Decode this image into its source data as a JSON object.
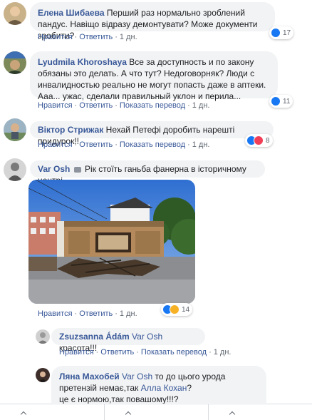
{
  "comments": [
    {
      "author": "Елена Шибаева",
      "text": "Перший раз нормально зроблений пандус. Навіщо відразу демонтувати? Може документи зробити?",
      "actions": {
        "like": "Нравится",
        "reply": "Ответить",
        "time": "1 дн."
      },
      "reactions": "17"
    },
    {
      "author": "Lyudmila Khoroshaya",
      "text": "Все за доступность и по закону обязаны это делать. А что тут? Недоговорняк? Люди с инвалидностью реально не могут попасть даже в аптеки. Ааа... ужас, сделали правильный уклон и перила...",
      "actions": {
        "like": "Нравится",
        "reply": "Ответить",
        "translate": "Показать перевод",
        "time": "1 дн."
      },
      "reactions": "11"
    },
    {
      "author": "Віктор Стрижак",
      "text": "Нехай Петефі доробить нарешті придурок!!",
      "actions": {
        "like": "Нравится",
        "reply": "Ответить",
        "translate": "Показать перевод",
        "time": "1 дн."
      },
      "reactions": "8"
    },
    {
      "author": "Var Osh",
      "text": "Рік стоїть ганьба фанерна в історичному центрі",
      "actions": {
        "like": "Нравится",
        "reply": "Ответить",
        "time": "1 дн."
      },
      "reactions": "14"
    }
  ],
  "replies": [
    {
      "author": "Zsuzsanna Ádám",
      "mention": "Var Osh",
      "text": "красота!!!",
      "actions": {
        "like": "Нравится",
        "reply": "Ответить",
        "translate": "Показать перевод",
        "time": "1 дн."
      }
    },
    {
      "author": "Ляна Махобей",
      "mention": "Var Osh",
      "text_a": "то до цього урода претензій немає,так",
      "mention2": "Алла Кохан",
      "text_b": "?",
      "text_c": "це є нормою,так повашому!!!?"
    }
  ],
  "colors": {
    "link": "#385898",
    "bubble": "#f2f3f5",
    "like": "#1877f2",
    "love": "#f33e58",
    "sad": "#f7b125"
  }
}
